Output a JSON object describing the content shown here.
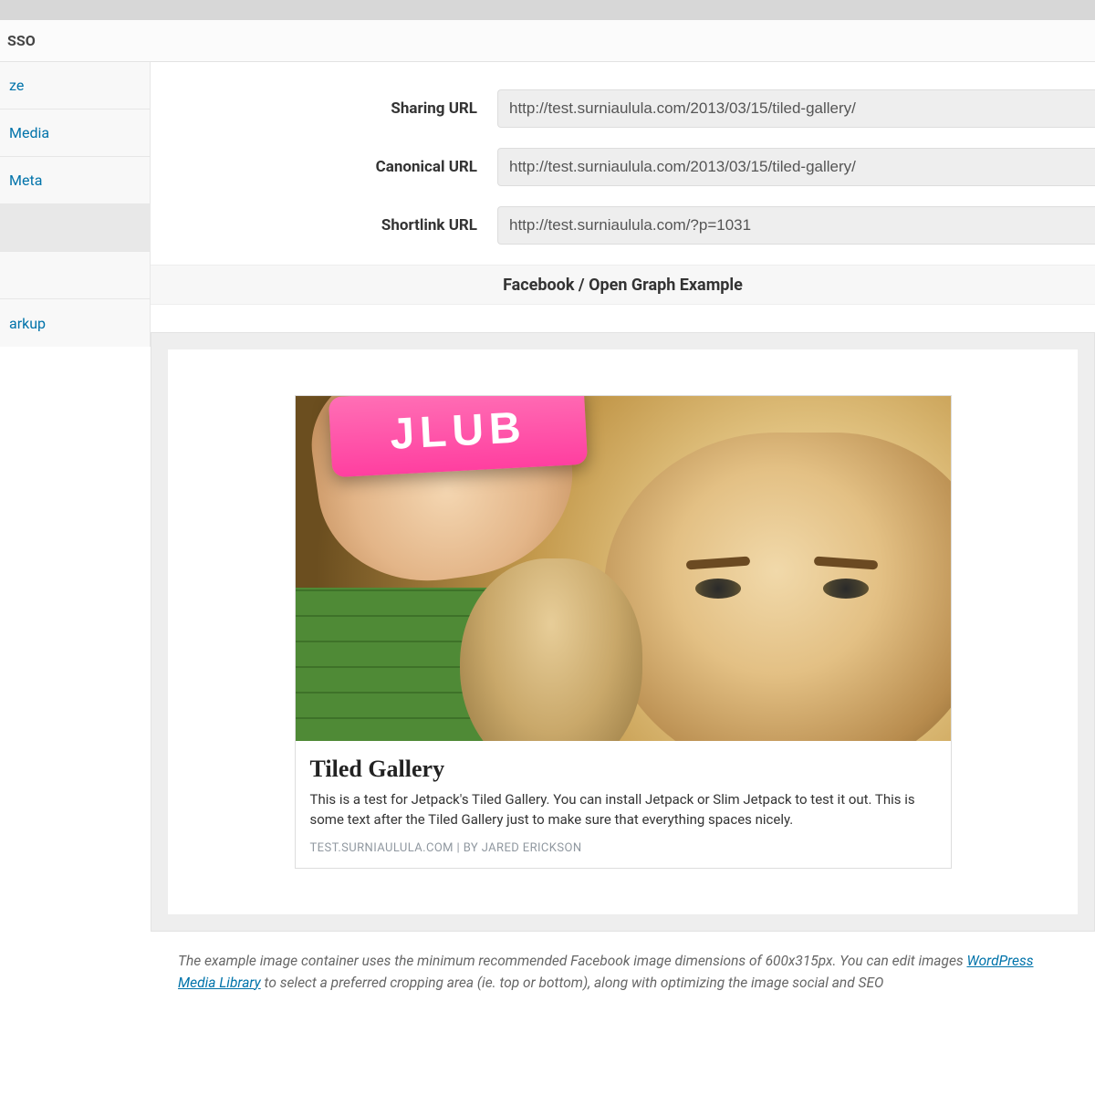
{
  "header": {
    "title": "SSO"
  },
  "sidebar": {
    "items": [
      {
        "label": "ze"
      },
      {
        "label": "Media"
      },
      {
        "label": "Meta"
      },
      {
        "label": ""
      },
      {
        "label": ""
      },
      {
        "label": "arkup"
      }
    ]
  },
  "fields": {
    "sharing": {
      "label": "Sharing URL",
      "value": "http://test.surniaulula.com/2013/03/15/tiled-gallery/"
    },
    "canonical": {
      "label": "Canonical URL",
      "value": "http://test.surniaulula.com/2013/03/15/tiled-gallery/"
    },
    "shortlink": {
      "label": "Shortlink URL",
      "value": "http://test.surniaulula.com/?p=1031"
    }
  },
  "section": {
    "heading": "Facebook / Open Graph Example"
  },
  "preview": {
    "soap_text": "JLUB",
    "title": "Tiled Gallery",
    "description": "This is a test for Jetpack's Tiled Gallery. You can install Jetpack or Slim Jetpack to test it out. This is some text after the Tiled Gallery just to make sure that everything spaces nicely.",
    "source": "TEST.SURNIAULULA.COM | BY JARED ERICKSON"
  },
  "note": {
    "text_before": "The example image container uses the minimum recommended Facebook image dimensions of 600x315px. You can edit images ",
    "link_text": "WordPress Media Library",
    "text_after": " to select a preferred cropping area (ie. top or bottom), along with optimizing the image social and SEO "
  }
}
